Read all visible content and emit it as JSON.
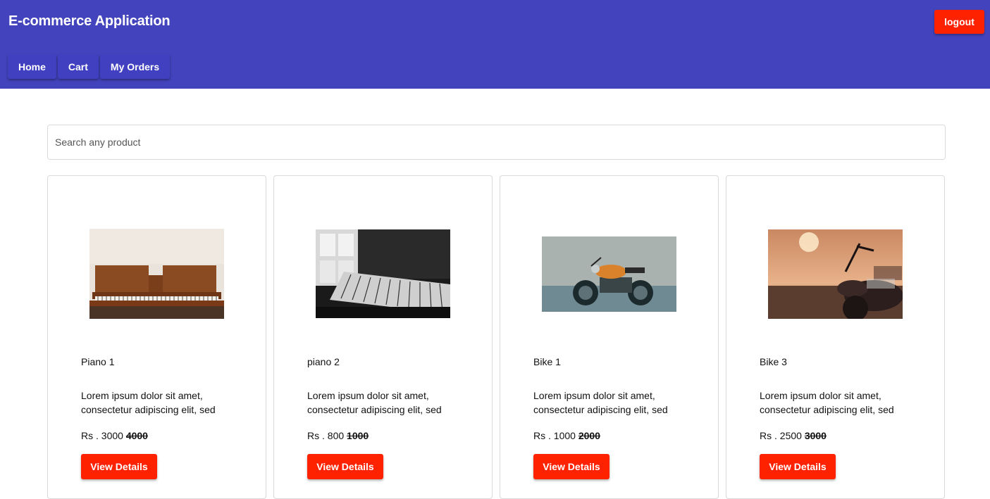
{
  "header": {
    "title": "E-commerce Application",
    "logout_label": "logout",
    "nav": [
      {
        "label": "Home"
      },
      {
        "label": "Cart"
      },
      {
        "label": "My Orders"
      }
    ]
  },
  "search": {
    "placeholder": "Search any product",
    "value": ""
  },
  "products": [
    {
      "name": "Piano 1",
      "description": "Lorem ipsum dolor sit amet, consectetur adipiscing elit, sed",
      "price_prefix": "Rs . ",
      "price": "3000",
      "original_price": "4000",
      "button_label": "View Details",
      "image": "piano-photo"
    },
    {
      "name": "piano 2",
      "description": "Lorem ipsum dolor sit amet, consectetur adipiscing elit, sed",
      "price_prefix": "Rs . ",
      "price": "800",
      "original_price": "1000",
      "button_label": "View Details",
      "image": "piano-keys-photo"
    },
    {
      "name": "Bike 1",
      "description": "Lorem ipsum dolor sit amet, consectetur adipiscing elit, sed",
      "price_prefix": "Rs . ",
      "price": "1000",
      "original_price": "2000",
      "button_label": "View Details",
      "image": "motorcycle-photo"
    },
    {
      "name": "Bike 3",
      "description": "Lorem ipsum dolor sit amet, consectetur adipiscing elit, sed",
      "price_prefix": "Rs . ",
      "price": "2500",
      "original_price": "3000",
      "button_label": "View Details",
      "image": "motorcycle-sunset-photo"
    }
  ],
  "colors": {
    "appbar": "#4343bd",
    "accent": "#ff2200"
  }
}
